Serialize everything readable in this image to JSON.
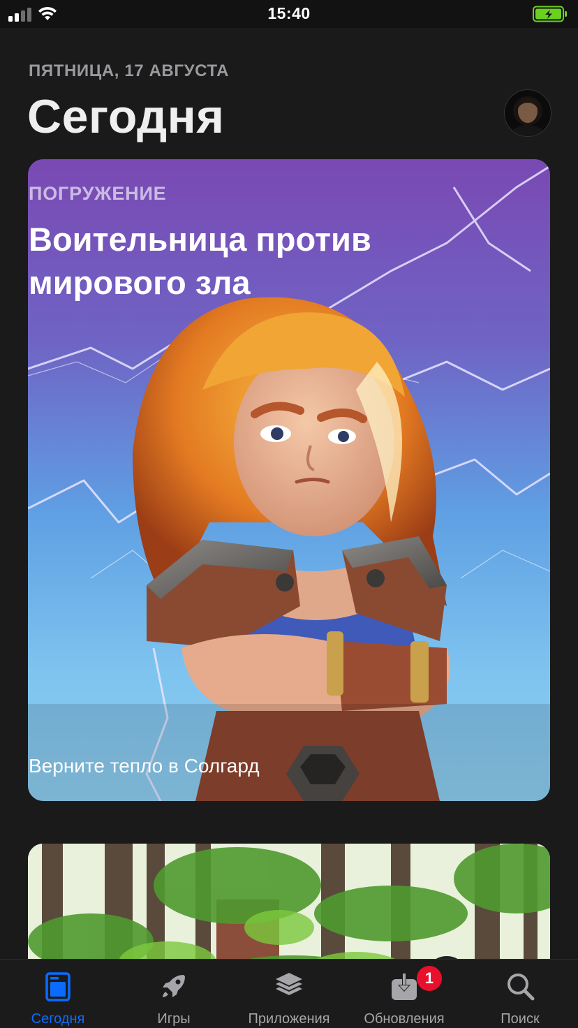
{
  "status_bar": {
    "time": "15:40",
    "signal": "signal-bars-icon",
    "wifi": "wifi-icon",
    "battery": "battery-charging-icon",
    "battery_color": "#6bd11f"
  },
  "header": {
    "date": "ПЯТНИЦА, 17 АВГУСТА",
    "title": "Сегодня",
    "avatar": "profile-avatar"
  },
  "feature_card": {
    "tag": "ПОГРУЖЕНИЕ",
    "title": "Воительница против мирового зла",
    "subtitle": "Верните тепло в Солгард"
  },
  "tabs": [
    {
      "label": "Сегодня",
      "icon": "today-icon",
      "active": true
    },
    {
      "label": "Игры",
      "icon": "rocket-icon",
      "active": false
    },
    {
      "label": "Приложения",
      "icon": "layers-icon",
      "active": false
    },
    {
      "label": "Обновления",
      "icon": "download-icon",
      "active": false,
      "badge": "1"
    },
    {
      "label": "Поиск",
      "icon": "search-icon",
      "active": false
    }
  ],
  "colors": {
    "accent": "#0a6cff",
    "badge": "#e8102c",
    "background": "#1a1a1a"
  }
}
